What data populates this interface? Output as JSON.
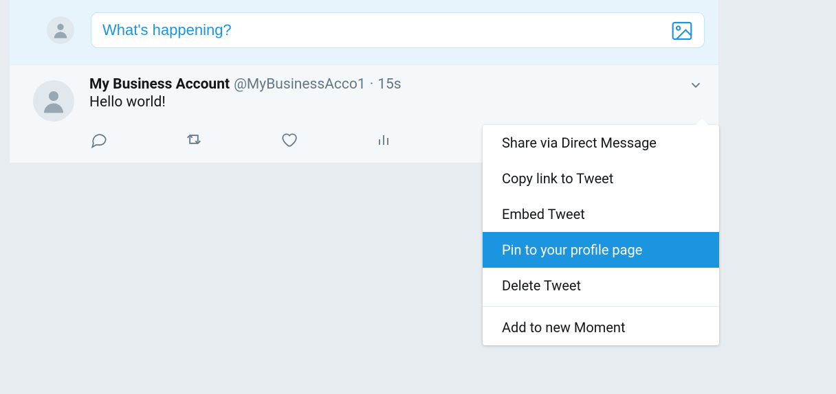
{
  "compose": {
    "placeholder": "What's happening?"
  },
  "tweet": {
    "name": "My Business Account",
    "handle": "@MyBusinessAcco1",
    "separator": "·",
    "time": "15s",
    "text": "Hello world!"
  },
  "menu": {
    "items": [
      {
        "label": "Share via Direct Message",
        "highlight": false
      },
      {
        "label": "Copy link to Tweet",
        "highlight": false
      },
      {
        "label": "Embed Tweet",
        "highlight": false
      },
      {
        "label": "Pin to your profile page",
        "highlight": true
      },
      {
        "label": "Delete Tweet",
        "highlight": false
      }
    ],
    "moment_label": "Add to new Moment"
  }
}
